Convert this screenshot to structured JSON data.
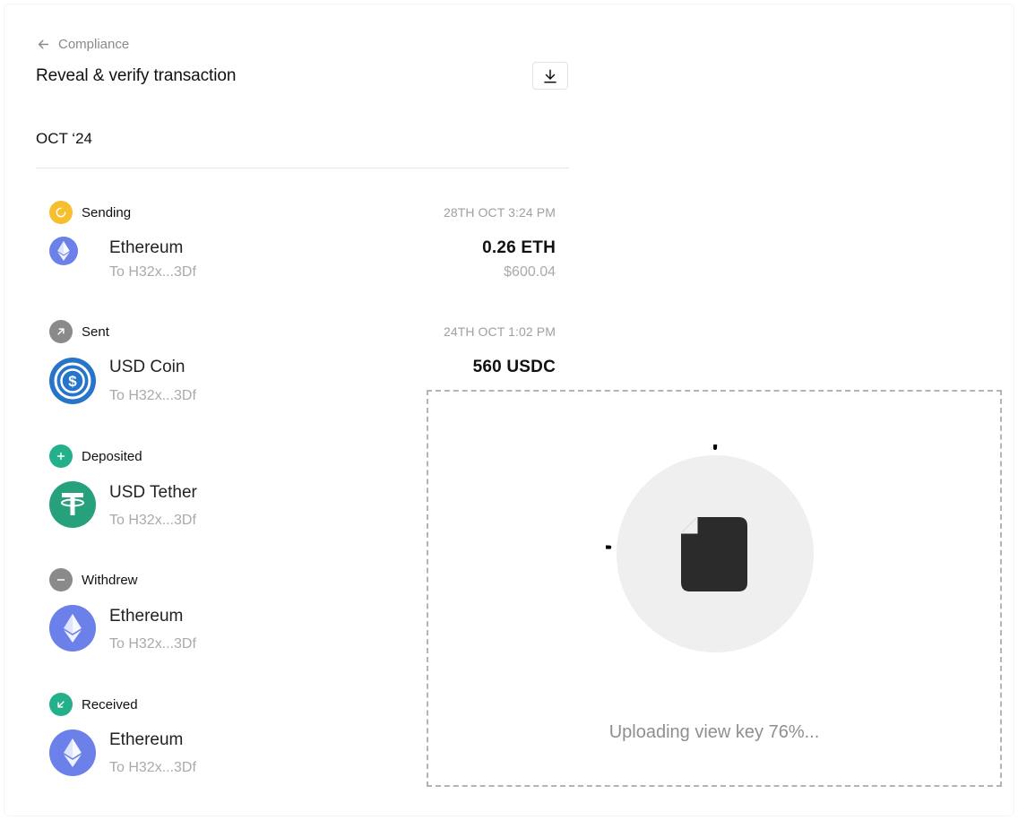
{
  "header": {
    "back_label": "Compliance",
    "title": "Reveal & verify transaction",
    "download_icon": "download-icon"
  },
  "month": "OCT ‘24",
  "transactions": [
    {
      "status": "Sending",
      "status_icon": "spinner-icon",
      "status_color": "#f5bf2e",
      "date": "28TH OCT 3:24 PM",
      "coin_name": "Ethereum",
      "coin_icon": "ethereum-icon",
      "to": "To H32x...3Df",
      "amount": "0.26 ETH",
      "fiat": "$600.04"
    },
    {
      "status": "Sent",
      "status_icon": "arrow-up-right-icon",
      "status_color": "#8a8a8a",
      "date": "24TH OCT 1:02 PM",
      "coin_name": "USD Coin",
      "coin_icon": "usdc-icon",
      "to": "To H32x...3Df",
      "amount": "560 USDC"
    },
    {
      "status": "Deposited",
      "status_icon": "plus-icon",
      "status_color": "#23b08a",
      "coin_name": "USD Tether",
      "coin_icon": "tether-icon",
      "to": "To H32x...3Df"
    },
    {
      "status": "Withdrew",
      "status_icon": "minus-icon",
      "status_color": "#8a8a8a",
      "coin_name": "Ethereum",
      "coin_icon": "ethereum-icon",
      "to": "To H32x...3Df"
    },
    {
      "status": "Received",
      "status_icon": "arrow-down-left-icon",
      "status_color": "#23b08a",
      "coin_name": "Ethereum",
      "coin_icon": "ethereum-icon",
      "to": "To H32x...3Df"
    }
  ],
  "upload": {
    "text": "Uploading view key 76%...",
    "progress": 0.76,
    "icon": "file-icon"
  },
  "colors": {
    "ethereum": "#6b80e8",
    "usdc": "#2775ca",
    "tether": "#26a17b"
  }
}
